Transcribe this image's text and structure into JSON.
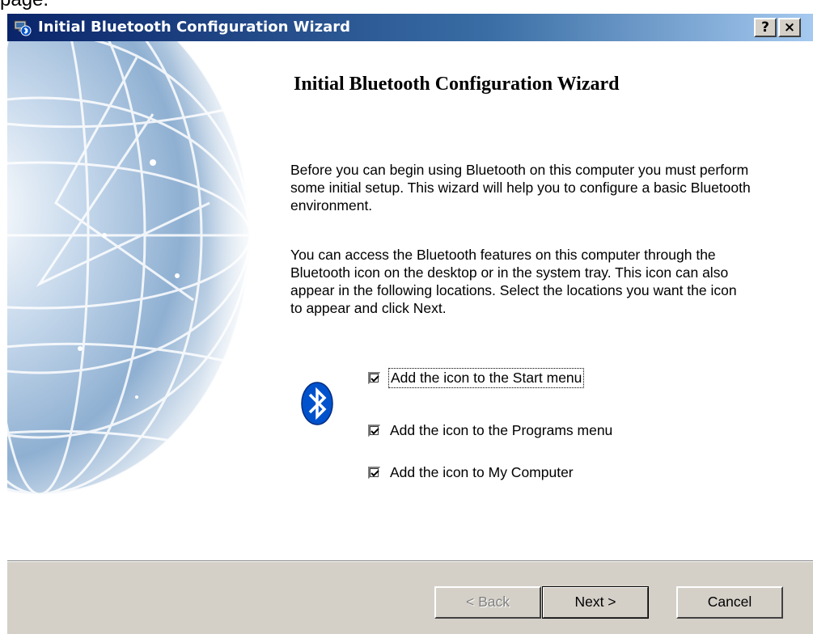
{
  "page_fragment": "page.",
  "window": {
    "title": "Initial Bluetooth Configuration Wizard",
    "help_label": "?",
    "close_label": "×"
  },
  "wizard": {
    "heading": "Initial Bluetooth Configuration Wizard",
    "paragraph1": "Before you can begin using Bluetooth on this computer you must perform some initial setup. This wizard will help you to configure a basic Bluetooth environment.",
    "paragraph2": "You can access the Bluetooth features on this computer through the Bluetooth icon on the desktop or in the system tray. This icon can also appear in the following locations. Select the locations you want the icon to appear and click Next.",
    "options": [
      {
        "label": "Add the icon to the Start menu",
        "checked": true
      },
      {
        "label": "Add the icon to the Programs menu",
        "checked": true
      },
      {
        "label": "Add the icon to My Computer",
        "checked": true
      }
    ]
  },
  "buttons": {
    "back": "< Back",
    "next": "Next >",
    "cancel": "Cancel"
  },
  "icons": {
    "app": "bluetooth-app-icon",
    "bluetooth": "bluetooth-icon",
    "illustration": "globe-illustration"
  },
  "colors": {
    "titlebar_start": "#0a246a",
    "titlebar_end": "#a6caf0",
    "bluetooth_blue": "#0052cc",
    "window_face": "#d4d0c8"
  }
}
